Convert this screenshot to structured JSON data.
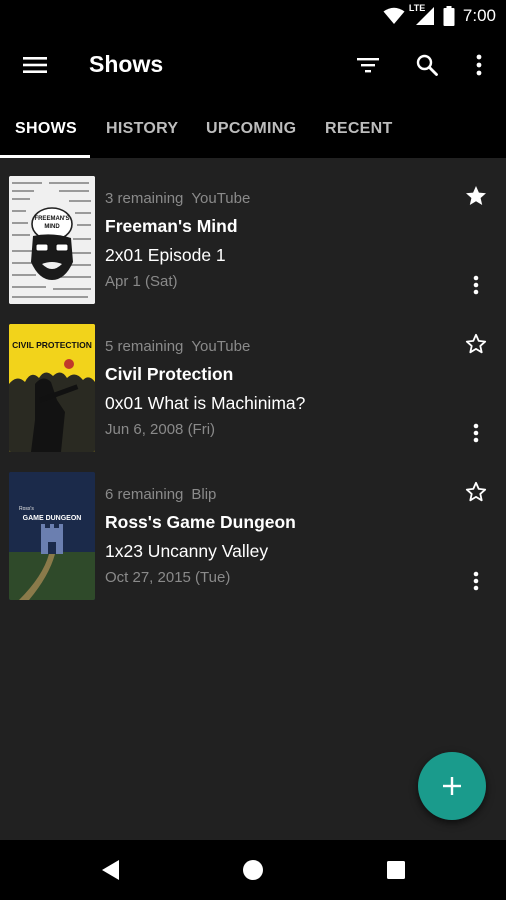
{
  "status_bar": {
    "network": "LTE",
    "time": "7:00"
  },
  "app_bar": {
    "title": "Shows",
    "icons": [
      "menu-icon",
      "filter-icon",
      "search-icon",
      "overflow-icon"
    ]
  },
  "tabs": [
    {
      "label": "SHOWS",
      "active": true
    },
    {
      "label": "HISTORY",
      "active": false
    },
    {
      "label": "UPCOMING",
      "active": false
    },
    {
      "label": "RECENT",
      "active": false
    }
  ],
  "shows": [
    {
      "remaining": "3 remaining",
      "network": "YouTube",
      "title": "Freeman's Mind",
      "episode": "2x01 Episode 1",
      "date": "Apr 1 (Sat)",
      "favorite": true,
      "poster_caption": "FREEMAN'S MIND"
    },
    {
      "remaining": "5 remaining",
      "network": "YouTube",
      "title": "Civil Protection",
      "episode": "0x01 What is Machinima?",
      "date": "Jun 6, 2008 (Fri)",
      "favorite": false,
      "poster_caption": "CIVIL PROTECTION"
    },
    {
      "remaining": "6 remaining",
      "network": "Blip",
      "title": "Ross's Game Dungeon",
      "episode": "1x23 Uncanny Valley",
      "date": "Oct 27, 2015 (Tue)",
      "favorite": false,
      "poster_caption": "GAME DUNGEON"
    }
  ],
  "fab": {
    "icon": "add-icon",
    "color": "#1a9b8c"
  },
  "nav_bar": {
    "icons": [
      "back-icon",
      "home-icon",
      "recents-icon"
    ]
  },
  "colors": {
    "background": "#212121",
    "bars": "#000000",
    "secondary_text": "#8a8a8a",
    "accent": "#1a9b8c"
  }
}
